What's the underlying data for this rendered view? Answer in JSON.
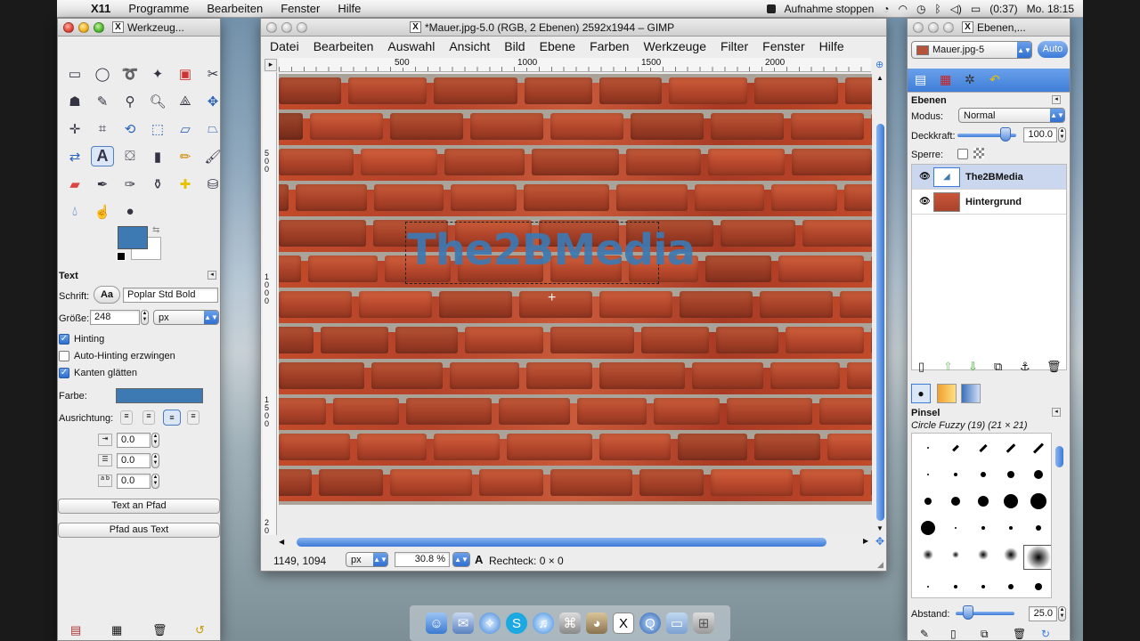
{
  "menubar": {
    "app_name": "X11",
    "items": [
      "Programme",
      "Bearbeiten",
      "Fenster",
      "Hilfe"
    ],
    "recording": "Aufnahme stoppen",
    "battery": "(0:37)",
    "clock": "Mo. 18:15"
  },
  "toolbox": {
    "title": "Werkzeug...",
    "tool_options_title": "Text",
    "font_label": "Schrift:",
    "font_value": "Poplar Std Bold",
    "font_preview": "Aa",
    "size_label": "Größe:",
    "size_value": "248",
    "size_unit": "px",
    "hinting": "Hinting",
    "autohint": "Auto-Hinting erzwingen",
    "antialias": "Kanten glätten",
    "color_label": "Farbe:",
    "justify_label": "Ausrichtung:",
    "indent_value": "0.0",
    "linespacing_value": "0.0",
    "letterspacing_value": "0.0",
    "btn_text_on_path": "Text an Pfad",
    "btn_path_from_text": "Pfad aus Text",
    "fg_color": "#3d79b3",
    "text_color": "#3d79b3"
  },
  "image_window": {
    "title": "*Mauer.jpg-5.0 (RGB, 2 Ebenen) 2592x1944 – GIMP",
    "menus": [
      "Datei",
      "Bearbeiten",
      "Auswahl",
      "Ansicht",
      "Bild",
      "Ebene",
      "Farben",
      "Werkzeuge",
      "Filter",
      "Fenster",
      "Hilfe"
    ],
    "ruler_h": [
      "500",
      "1000",
      "1500",
      "2000"
    ],
    "ruler_v": [
      "5\n0\n0",
      "1\n0\n0\n0",
      "1\n5\n0\n0",
      "2\n0"
    ],
    "overlay_text": "The2BMedia",
    "coords": "1149, 1094",
    "unit": "px",
    "zoom": "30.8 %",
    "status": "Rechteck: 0 × 0"
  },
  "layers_window": {
    "title": "Ebenen,...",
    "image_select": "Mauer.jpg-5",
    "auto_button": "Auto",
    "panel_title": "Ebenen",
    "mode_label": "Modus:",
    "mode_value": "Normal",
    "opacity_label": "Deckkraft:",
    "opacity_value": "100.0",
    "lock_label": "Sperre:",
    "layers": [
      {
        "name": "The2BMedia",
        "selected": true
      },
      {
        "name": "Hintergrund",
        "selected": false
      }
    ],
    "brushes_title": "Pinsel",
    "brush_name": "Circle Fuzzy (19) (21 × 21)",
    "spacing_label": "Abstand:",
    "spacing_value": "25.0"
  }
}
